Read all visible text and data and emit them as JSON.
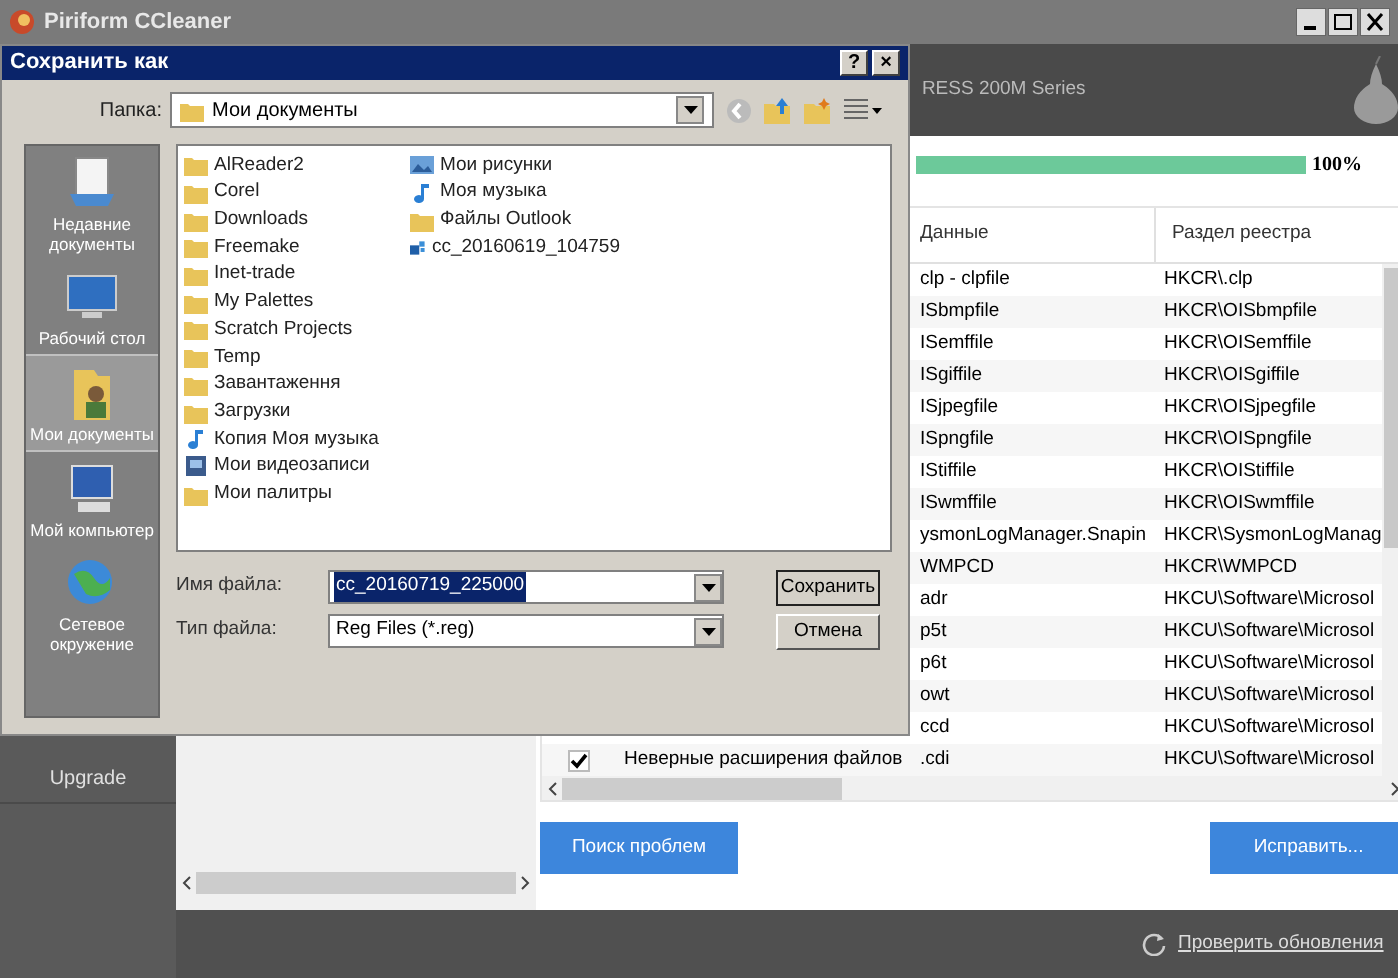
{
  "app": {
    "title": "Piriform CCleaner",
    "header_text": "RESS 200M Series",
    "progress": {
      "level": 1,
      "reading": "100%"
    },
    "sidebar": {
      "items": [
        {
          "label": "Upgrade"
        }
      ]
    },
    "table": {
      "columns": [
        "Данные",
        "Раздел реестра"
      ],
      "rows": [
        {
          "kind": "covered",
          "data": "clp - clpfile",
          "key": "HKCR\\.clp"
        },
        {
          "kind": "covered",
          "data": "ISbmpfile",
          "key": "HKCR\\OISbmpfile"
        },
        {
          "kind": "covered",
          "data": "ISemffile",
          "key": "HKCR\\OISemffile"
        },
        {
          "kind": "covered",
          "data": "ISgiffile",
          "key": "HKCR\\OISgiffile"
        },
        {
          "kind": "covered",
          "data": "ISjpegfile",
          "key": "HKCR\\OISjpegfile"
        },
        {
          "kind": "covered",
          "data": "ISpngfile",
          "key": "HKCR\\OISpngfile"
        },
        {
          "kind": "covered",
          "data": "IStiffile",
          "key": "HKCR\\OIStiffile"
        },
        {
          "kind": "covered",
          "data": "ISwmffile",
          "key": "HKCR\\OISwmffile"
        },
        {
          "kind": "covered",
          "data": "ysmonLogManager.Snapin",
          "key": "HKCR\\SysmonLogManag"
        },
        {
          "kind": "covered",
          "data": "WMPCD",
          "key": "HKCR\\WMPCD"
        },
        {
          "kind": "covered",
          "data": "adr",
          "key": "HKCU\\Software\\Microsol"
        },
        {
          "kind": "covered",
          "data": "p5t",
          "key": "HKCU\\Software\\Microsol"
        },
        {
          "kind": "covered",
          "data": "p6t",
          "key": "HKCU\\Software\\Microsol"
        },
        {
          "kind": "covered",
          "data": "owt",
          "key": "HKCU\\Software\\Microsol"
        },
        {
          "kind": "covered",
          "data": "ccd",
          "key": "HKCU\\Software\\Microsol"
        },
        {
          "kind": "full",
          "checked": true,
          "issue": "Неверные расширения файлов",
          "data": ".cdi",
          "key": "HKCU\\Software\\Microsol"
        }
      ]
    },
    "buttons": [
      "Поиск проблем",
      "Исправить..."
    ],
    "update_link": "Проверить обновления"
  },
  "dialog": {
    "title": "Сохранить как",
    "title_buttons": [
      "?",
      "×"
    ],
    "folder_label": "Папка:",
    "folder": "Мои документы",
    "places": [
      {
        "label": "Недавние документы",
        "kind": "recent",
        "selected": false
      },
      {
        "label": "Рабочий стол",
        "kind": "desktop",
        "selected": false
      },
      {
        "label": "Мои документы",
        "kind": "documents",
        "selected": true
      },
      {
        "label": "Мой компьютер",
        "kind": "computer",
        "selected": false
      },
      {
        "label": "Сетевое окружение",
        "kind": "network",
        "selected": false
      }
    ],
    "files": [
      {
        "name": "AlReader2",
        "kind": "folder"
      },
      {
        "name": "Corel",
        "kind": "folder"
      },
      {
        "name": "Downloads",
        "kind": "folder"
      },
      {
        "name": "Freemake",
        "kind": "folder"
      },
      {
        "name": "Inet-trade",
        "kind": "folder"
      },
      {
        "name": "My Palettes",
        "kind": "folder"
      },
      {
        "name": "Scratch Projects",
        "kind": "folder"
      },
      {
        "name": "Temp",
        "kind": "folder"
      },
      {
        "name": "Завантаження",
        "kind": "folder"
      },
      {
        "name": "Загрузки",
        "kind": "folder"
      },
      {
        "name": "Копия Моя музыка",
        "kind": "music"
      },
      {
        "name": "Мои видеозаписи",
        "kind": "video"
      },
      {
        "name": "Мои палитры",
        "kind": "folder"
      },
      {
        "name": "Мои рисунки",
        "kind": "pictures"
      },
      {
        "name": "Моя музыка",
        "kind": "music"
      },
      {
        "name": "Файлы Outlook",
        "kind": "folder"
      },
      {
        "name": "cc_20160619_104759",
        "kind": "registry"
      }
    ],
    "filename_label": "Имя файла:",
    "filename": "cc_20160719_225000",
    "filetype_label": "Тип файла:",
    "filetype": "Reg Files (*.reg)",
    "buttons": [
      "Сохранить",
      "Отмена"
    ]
  }
}
